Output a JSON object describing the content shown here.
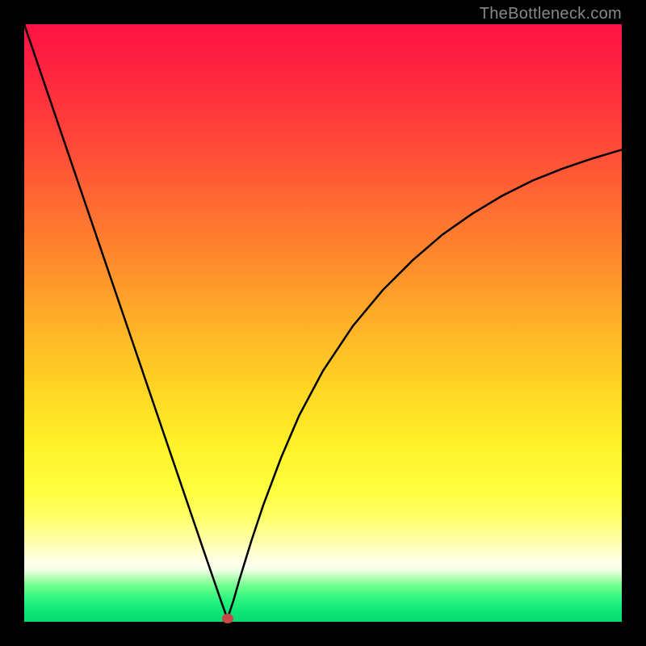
{
  "watermark": "TheBottleneck.com",
  "marker_color": "#c84848",
  "chart_data": {
    "type": "line",
    "title": "",
    "xlabel": "",
    "ylabel": "",
    "xlim": [
      0,
      100
    ],
    "ylim": [
      0,
      100
    ],
    "gradient_stops": [
      {
        "offset": 0.0,
        "color": "#ff1244"
      },
      {
        "offset": 0.1,
        "color": "#ff2a3e"
      },
      {
        "offset": 0.2,
        "color": "#ff4838"
      },
      {
        "offset": 0.3,
        "color": "#ff6a32"
      },
      {
        "offset": 0.4,
        "color": "#ff8c2c"
      },
      {
        "offset": 0.5,
        "color": "#ffb028"
      },
      {
        "offset": 0.6,
        "color": "#ffd224"
      },
      {
        "offset": 0.7,
        "color": "#fff028"
      },
      {
        "offset": 0.78,
        "color": "#ffff40"
      },
      {
        "offset": 0.82,
        "color": "#ffff60"
      },
      {
        "offset": 0.86,
        "color": "#ffffa0"
      },
      {
        "offset": 0.89,
        "color": "#ffffd8"
      },
      {
        "offset": 0.905,
        "color": "#fffff0"
      },
      {
        "offset": 0.915,
        "color": "#e8ffe0"
      },
      {
        "offset": 0.925,
        "color": "#b8ffb8"
      },
      {
        "offset": 0.94,
        "color": "#70ff90"
      },
      {
        "offset": 0.96,
        "color": "#30f880"
      },
      {
        "offset": 0.98,
        "color": "#10e878"
      },
      {
        "offset": 1.0,
        "color": "#08d870"
      }
    ],
    "curve": {
      "x": [
        0,
        3,
        6,
        9,
        12,
        15,
        18,
        21,
        24,
        27,
        30,
        32,
        33,
        34,
        35,
        36,
        38,
        40,
        43,
        46,
        50,
        55,
        60,
        65,
        70,
        75,
        80,
        85,
        90,
        95,
        100
      ],
      "y": [
        100,
        91.2,
        82.4,
        73.6,
        64.8,
        56.0,
        47.2,
        38.4,
        29.6,
        20.8,
        12.0,
        6.2,
        3.3,
        0.5,
        3.5,
        7.0,
        13.5,
        19.5,
        27.5,
        34.5,
        42.0,
        49.5,
        55.5,
        60.5,
        64.8,
        68.3,
        71.3,
        73.8,
        75.8,
        77.5,
        79.0
      ]
    },
    "marker": {
      "x": 34,
      "y": 0.5
    }
  }
}
